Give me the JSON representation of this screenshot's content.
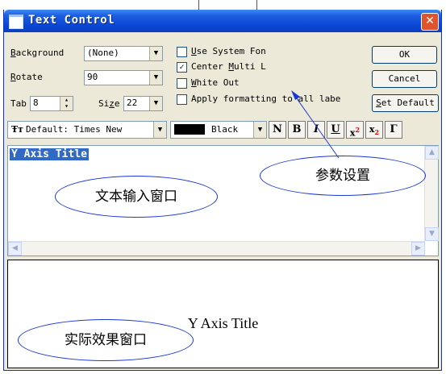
{
  "window": {
    "title": "Text Control",
    "close_glyph": "✕"
  },
  "controls": {
    "background_label_u": "B",
    "background_label_rest": "ackground",
    "background_value": "(None)",
    "rotate_label_u": "R",
    "rotate_label_rest": "otate",
    "rotate_value": "90",
    "tab_label": "Tab",
    "tab_value": "8",
    "size_label_a": "Si",
    "size_label_u": "z",
    "size_label_b": "e",
    "size_value": "22"
  },
  "options": [
    {
      "u": "U",
      "rest": "se System Fon",
      "checked": false
    },
    {
      "pre": "Center ",
      "u": "M",
      "rest": "ulti L",
      "checked": true
    },
    {
      "u": "W",
      "rest": "hite Out",
      "checked": false
    },
    {
      "u": "",
      "rest": "Apply formatting to all labe",
      "checked": false
    }
  ],
  "buttons": {
    "ok": "OK",
    "cancel": "Cancel",
    "set_default_u": "S",
    "set_default_rest": "et Default"
  },
  "format_bar": {
    "font_value": "Default: Times New",
    "color_value": "Black",
    "normal": "N",
    "bold": "B",
    "italic": "I",
    "underline": "U",
    "superscript": "x",
    "superscript_mark": "2",
    "subscript": "x",
    "subscript_mark": "2",
    "greek": "Γ"
  },
  "editor": {
    "text": "Y Axis Title"
  },
  "preview": {
    "text": "Y Axis Title"
  },
  "annotations": {
    "param": "参数设置",
    "input": "文本输入窗口",
    "result": "实际效果窗口"
  },
  "colors": {
    "titlebar": "#0a47d6",
    "selection": "#316ac5",
    "annotation": "#1a37d8",
    "color_swatch": "#000000"
  }
}
